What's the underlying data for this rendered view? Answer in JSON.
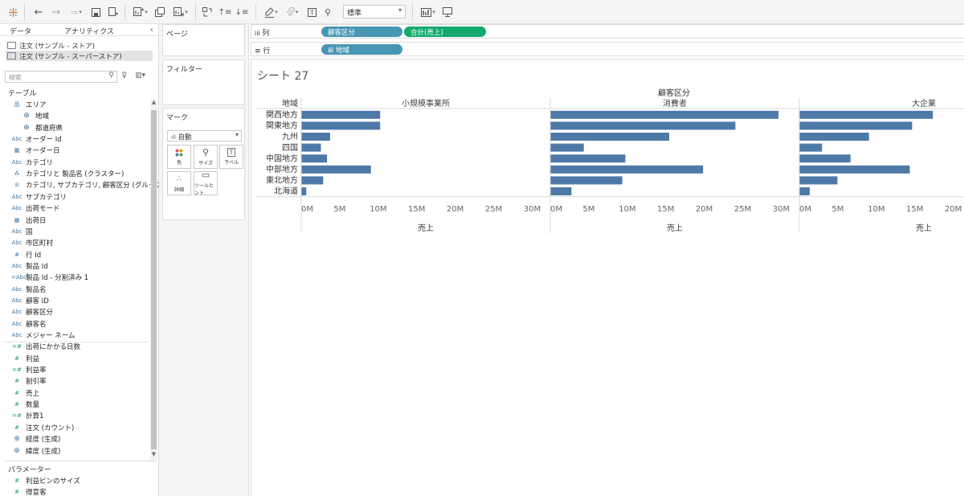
{
  "toolbar": {
    "fit_select": "標準",
    "icons": [
      "tableau-logo-icon",
      "back-icon",
      "forward-icon",
      "redo-icon",
      "save-icon",
      "add-datasource-icon",
      "new-worksheet-icon",
      "duplicate-icon",
      "clear-sheet-icon",
      "swap-icon",
      "sort-ascending-icon",
      "sort-descending-icon",
      "highlight-icon",
      "group-icon",
      "label-icon",
      "pin-icon",
      "show-me-icon",
      "presentation-icon"
    ]
  },
  "data_pane": {
    "tabs": [
      "データ",
      "アナリティクス"
    ],
    "collapse": "‹",
    "datasources": [
      "注文 (サンプル - ストア)",
      "注文 (サンプル - スーパーストア)"
    ],
    "search_placeholder": "検索",
    "table_heading": "テーブル",
    "fields": [
      {
        "label": "エリア",
        "icon": "品",
        "kind": "hier",
        "indent": 0
      },
      {
        "label": "地域",
        "icon": "⊕",
        "kind": "globe",
        "indent": 1
      },
      {
        "label": "都道府県",
        "icon": "⊕",
        "kind": "globe",
        "indent": 1
      },
      {
        "label": "オーダー Id",
        "icon": "Abc",
        "kind": "dim",
        "indent": 0
      },
      {
        "label": "オーダー日",
        "icon": "▦",
        "kind": "date",
        "indent": 0
      },
      {
        "label": "カテゴリ",
        "icon": "Abc",
        "kind": "dim",
        "indent": 0
      },
      {
        "label": "カテゴリと 製品名 (クラスター)",
        "icon": "⁂",
        "kind": "dim",
        "indent": 0
      },
      {
        "label": "カテゴリ, サブカテゴリ, 顧客区分 (グループ)",
        "icon": "⊘",
        "kind": "dim",
        "indent": 0
      },
      {
        "label": "サブカテゴリ",
        "icon": "Abc",
        "kind": "dim",
        "indent": 0
      },
      {
        "label": "出荷モード",
        "icon": "Abc",
        "kind": "dim",
        "indent": 0
      },
      {
        "label": "出荷日",
        "icon": "▦",
        "kind": "date",
        "indent": 0
      },
      {
        "label": "国",
        "icon": "Abc",
        "kind": "dim",
        "indent": 0
      },
      {
        "label": "市区町村",
        "icon": "Abc",
        "kind": "dim",
        "indent": 0
      },
      {
        "label": "行 Id",
        "icon": "#",
        "kind": "dim",
        "indent": 0
      },
      {
        "label": "製品 Id",
        "icon": "Abc",
        "kind": "dim",
        "indent": 0
      },
      {
        "label": "製品 Id - 分割済み 1",
        "icon": "=Abc",
        "kind": "dim",
        "indent": 0
      },
      {
        "label": "製品名",
        "icon": "Abc",
        "kind": "dim",
        "indent": 0
      },
      {
        "label": "顧客 ID",
        "icon": "Abc",
        "kind": "dim",
        "indent": 0
      },
      {
        "label": "顧客区分",
        "icon": "Abc",
        "kind": "dim",
        "indent": 0
      },
      {
        "label": "顧客名",
        "icon": "Abc",
        "kind": "dim",
        "indent": 0
      },
      {
        "label": "メジャー ネーム",
        "icon": "Abc",
        "kind": "dim",
        "indent": 0
      },
      {
        "label": "出荷にかかる日数",
        "icon": "=#",
        "kind": "meas",
        "indent": 0
      },
      {
        "label": "利益",
        "icon": "#",
        "kind": "meas",
        "indent": 0
      },
      {
        "label": "利益率",
        "icon": "=#",
        "kind": "meas",
        "indent": 0
      },
      {
        "label": "割引率",
        "icon": "#",
        "kind": "meas",
        "indent": 0
      },
      {
        "label": "売上",
        "icon": "#",
        "kind": "meas",
        "indent": 0
      },
      {
        "label": "数量",
        "icon": "#",
        "kind": "meas",
        "indent": 0
      },
      {
        "label": "計算1",
        "icon": "=#",
        "kind": "meas",
        "indent": 0
      },
      {
        "label": "注文 (カウント)",
        "icon": "#",
        "kind": "meas",
        "indent": 0
      },
      {
        "label": "経度 (生成)",
        "icon": "⊕",
        "kind": "measglobe",
        "indent": 0
      },
      {
        "label": "緯度 (生成)",
        "icon": "⊕",
        "kind": "measglobe",
        "indent": 0
      }
    ],
    "param_heading": "パラメーター",
    "params": [
      {
        "label": "利益ビンのサイズ",
        "icon": "#"
      },
      {
        "label": "得意客",
        "icon": "#"
      }
    ]
  },
  "cards": {
    "pages": "ページ",
    "filters": "フィルター",
    "marks": "マーク",
    "mark_type": "自動",
    "mark_buttons": [
      "色",
      "サイズ",
      "ラベル",
      "詳細",
      "ツールヒント"
    ]
  },
  "shelves": {
    "columns_label": "列",
    "rows_label": "行",
    "columns_pills": [
      "顧客区分",
      "合計(売上)"
    ],
    "rows_pills": [
      "⊞ 地域"
    ]
  },
  "sheet": {
    "title": "シート 27"
  },
  "chart_data": {
    "type": "bar",
    "orientation": "horizontal",
    "title": "",
    "column_header": "顧客区分",
    "row_header": "地域",
    "xlabel": "売上",
    "categories": [
      "関西地方",
      "関東地方",
      "九州",
      "四国",
      "中国地方",
      "中部地方",
      "東北地方",
      "北海道"
    ],
    "x_ticks": [
      "0M",
      "5M",
      "10M",
      "15M",
      "20M",
      "25M",
      "30M"
    ],
    "xlim": [
      0,
      31000000
    ],
    "bar_color": "#4e79a7",
    "panels": [
      {
        "name": "小規模事業所",
        "values": [
          10200000,
          10200000,
          3700000,
          2500000,
          3300000,
          9000000,
          2800000,
          600000
        ]
      },
      {
        "name": "消費者",
        "values": [
          29600000,
          24000000,
          15400000,
          4300000,
          9700000,
          19800000,
          9300000,
          2700000
        ]
      },
      {
        "name": "大企業",
        "values": [
          17300000,
          14600000,
          9000000,
          2900000,
          6600000,
          14300000,
          4900000,
          1300000
        ]
      }
    ]
  }
}
